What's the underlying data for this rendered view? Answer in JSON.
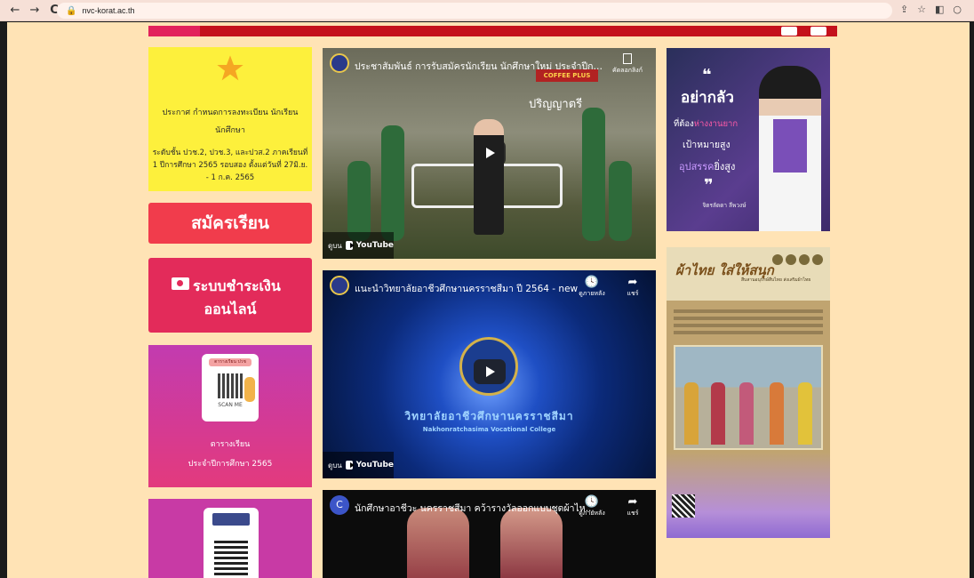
{
  "browser": {
    "url": "nvc-korat.ac.th",
    "back_icon": "←",
    "forward_icon": "→",
    "reload_icon": "C"
  },
  "announcement": {
    "title": "ประกาศ กำหนดการลงทะเบียน นักเรียน นักศึกษา",
    "body": "ระดับชั้น ปวช.2, ปวช.3, และปวส.2 ภาคเรียนที่ 1 ปีการศึกษา 2565 รอบสอง ตั้งแต่วันที่ 27มิ.ย. - 1 ก.ค. 2565"
  },
  "apply_button": "สมัครเรียน",
  "payment": {
    "line1": "ระบบชำระเงิน",
    "line2": "ออนไลน์"
  },
  "schedule": {
    "tag": "ตารางเรียน ปวช",
    "scan": "SCAN ME",
    "title": "ตารางเรียน",
    "subtitle": "ประจำปีการศึกษา 2565"
  },
  "videos": [
    {
      "title": "ประชาสัมพันธ์ การรับสมัครนักเรียน นักศึกษาใหม่ ประจำปีการศึกษ...",
      "action": "คัดลอกลิงก์",
      "overlay": "ปริญญาตรี",
      "sign": "COFFEE PLUS",
      "watch_on": "ดูบน",
      "youtube": "YouTube"
    },
    {
      "title": "แนะนำวิทยาลัยอาชีวศึกษานครราชสีมา ปี 2564 - new",
      "action1": "ดูภายหลัง",
      "action2": "แชร์",
      "college_th": "วิทยาลัยอาชีวศึกษานครราชสีมา",
      "college_en": "Nakhonratchasima Vocational College",
      "watch_on": "ดูบน",
      "youtube": "YouTube"
    },
    {
      "avatar": "C",
      "title": "นักศึกษาอาชีวะ นครราชสีมา คว้ารางวัลออกแบบชุดผ้าไห...",
      "action1": "ดูภายหลัง",
      "action2": "แชร์"
    }
  ],
  "poster1": {
    "quote_open": "❝",
    "headline": "อย่ากลัว",
    "line2_a": "ที่ต้อง",
    "line2_b": "ห่างงานยาก",
    "line3": "เป้าหมายสูง",
    "line4_a": "อุปสรรค",
    "line4_b": "ยิ่งสูง",
    "quote_close": "❞",
    "signature": "จิตรลัดดา ลีพวงษ์"
  },
  "poster2": {
    "logo": "ผ้าไทย ใส่ให้สนุก",
    "subtitle": "สืบสานอนุรักษ์สืบไทย ส่งเสริมผ้าไทย"
  }
}
